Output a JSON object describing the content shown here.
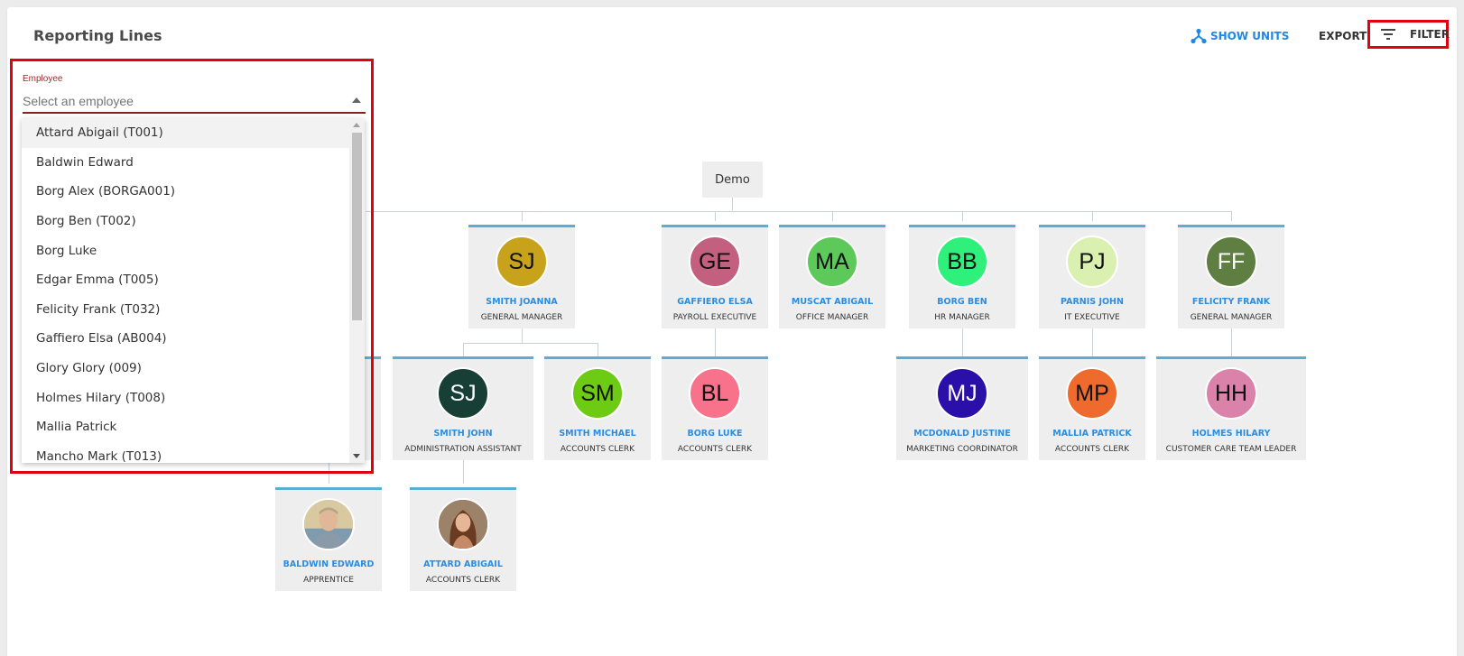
{
  "header": {
    "title": "Reporting Lines",
    "show_units_label": "SHOW UNITS",
    "export_label": "EXPORT",
    "filter_label": "FILTER"
  },
  "employee_filter": {
    "label": "Employee",
    "placeholder": "Select an employee",
    "options": [
      "Attard Abigail (T001)",
      "Baldwin Edward",
      "Borg Alex (BORGA001)",
      "Borg Ben (T002)",
      "Borg Luke",
      "Edgar Emma (T005)",
      "Felicity Frank (T032)",
      "Gaffiero Elsa (AB004)",
      "Glory Glory (009)",
      "Holmes Hilary (T008)",
      "Mallia Patrick",
      "Mancho Mark (T013)"
    ]
  },
  "org_chart": {
    "root": "Demo",
    "nodes": [
      {
        "initials": "SJ",
        "name": "SMITH JOANNA",
        "title": "GENERAL MANAGER",
        "color": "#c9a21c"
      },
      {
        "initials": "GE",
        "name": "GAFFIERO ELSA",
        "title": "PAYROLL EXECUTIVE",
        "color": "#c4607f"
      },
      {
        "initials": "MA",
        "name": "MUSCAT ABIGAIL",
        "title": "OFFICE MANAGER",
        "color": "#5dc95a"
      },
      {
        "initials": "BB",
        "name": "BORG BEN",
        "title": "HR MANAGER",
        "color": "#2ef07a"
      },
      {
        "initials": "PJ",
        "name": "PARNIS JOHN",
        "title": "IT EXECUTIVE",
        "color": "#daf0b0"
      },
      {
        "initials": "FF",
        "name": "FELICITY FRANK",
        "title": "GENERAL MANAGER",
        "color": "#5e7e42"
      },
      {
        "initials": "SJ",
        "name": "SMITH JOHN",
        "title": "ADMINISTRATION ASSISTANT",
        "color": "#173f36"
      },
      {
        "initials": "SM",
        "name": "SMITH MICHAEL",
        "title": "ACCOUNTS CLERK",
        "color": "#6ecb14"
      },
      {
        "initials": "BL",
        "name": "BORG LUKE",
        "title": "ACCOUNTS CLERK",
        "color": "#f7728a"
      },
      {
        "initials": "MJ",
        "name": "MCDONALD JUSTINE",
        "title": "MARKETING COORDINATOR",
        "color": "#2a10a8"
      },
      {
        "initials": "MP",
        "name": "MALLIA PATRICK",
        "title": "ACCOUNTS CLERK",
        "color": "#ee6a2d"
      },
      {
        "initials": "HH",
        "name": "HOLMES HILARY",
        "title": "CUSTOMER CARE TEAM LEADER",
        "color": "#db82ab"
      },
      {
        "initials": "",
        "name": "BALDWIN EDWARD",
        "title": "APPRENTICE",
        "photo": "man-photo"
      },
      {
        "initials": "",
        "name": "ATTARD ABIGAIL",
        "title": "ACCOUNTS CLERK",
        "photo": "woman-photo"
      }
    ]
  }
}
